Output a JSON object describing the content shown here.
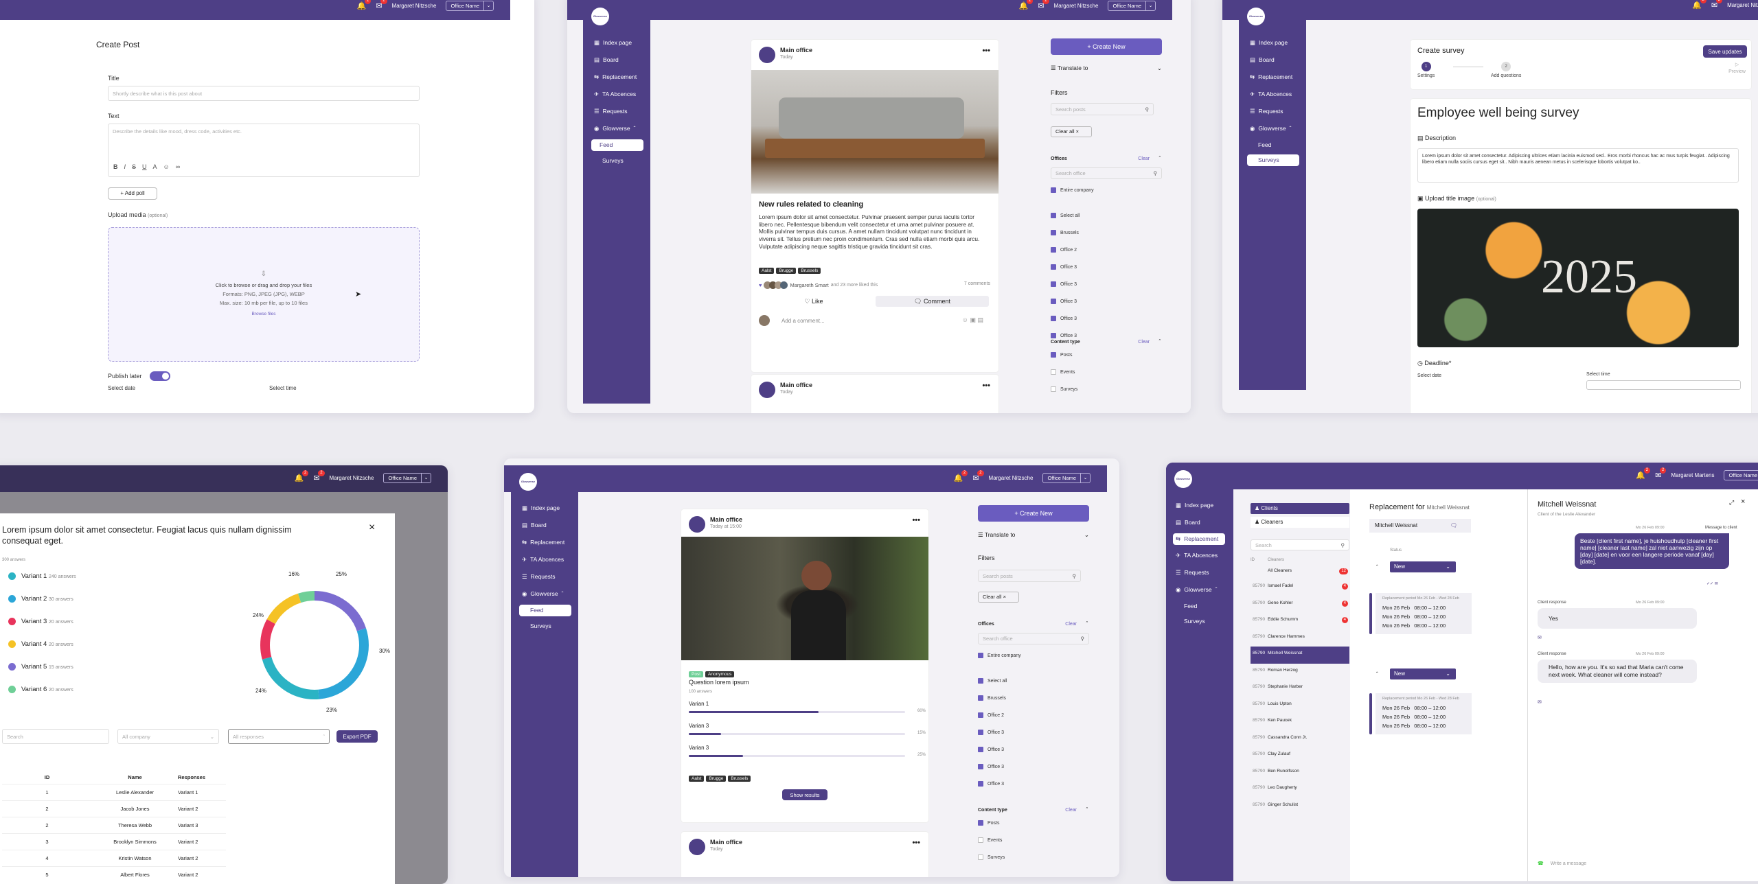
{
  "topbar": {
    "user": "Margaret Nitzsche",
    "office": "Office Name",
    "bell_count": "2",
    "mail_count": "2"
  },
  "topbar_alt": {
    "user": "Margaret Martens"
  },
  "logo_text": "Glowverse",
  "nav": {
    "index": "Index page",
    "board": "Board",
    "replacement": "Replacement",
    "ta": "TA Abcences",
    "requests": "Requests",
    "glowverse": "Glowverse",
    "feed": "Feed",
    "surveys": "Surveys"
  },
  "create_post": {
    "heading": "Create Post",
    "title_label": "Title",
    "title_placeholder": "Shortly describe what is this post about",
    "text_label": "Text",
    "text_placeholder": "Describe the details like mood, dress code, activities etc.",
    "add_poll": "+ Add poll",
    "upload_label": "Upload media",
    "optional": "(optional)",
    "drop_1": "Click to browse or drag and drop your files",
    "drop_2": "Formats: PNG, JPEG (JPG), WEBP",
    "drop_3": "Max. size: 10 mb per file, up to 10 files",
    "browse": "Browse files",
    "publish_later": "Publish later",
    "select_date": "Select date",
    "select_time": "Select time"
  },
  "feed": {
    "office": "Main office",
    "today": "Today",
    "today_time": "Today at 15:00",
    "post_title": "New rules related to cleaning",
    "body": "Lorem ipsum dolor sit amet consectetur. Pulvinar praesent semper purus iaculis tortor libero nec. Pellentesque bibendum velit consectetur et urna amet pulvinar posuere at. Mollis pulvinar tempus duis cursus. A amet nullam tincidunt volutpat nunc tincidunt in viverra sit. Tellus pretium nec proin condimentum. Cras sed nulla etiam morbi quis arcu. Vulputate adipiscing neque sagittis tristique gravida tincidunt sit cras.",
    "tags": [
      "Aalst",
      "Brugge",
      "Brussels"
    ],
    "likes": "Margareth Smart",
    "likes_more": "and 23 more liked this",
    "comments": "7 comments",
    "like": "Like",
    "comment": "Comment",
    "add_comment": "Add a comment...",
    "more": "•••"
  },
  "filters": {
    "create_new": "+ Create New",
    "translate": "Translate to",
    "filters": "Filters",
    "search_posts": "Search posts",
    "clear_all": "Clear all",
    "offices": "Offices",
    "clear": "Clear",
    "search_office": "Search office",
    "entire_company": "Entire company",
    "select_all": "Select all",
    "brussels": "Brussels",
    "office_2": "Office 2",
    "office_3": "Office 3",
    "content_type": "Content type",
    "posts": "Posts",
    "events": "Events",
    "surveys": "Surveys"
  },
  "survey": {
    "heading": "Create survey",
    "save": "Save updates",
    "step1": "Settings",
    "step2": "Add questions",
    "step3": "Preview",
    "title": "Employee well being survey",
    "desc_label": "Description",
    "desc": "Lorem ipsum dolor sit amet consectetur. Adipiscing ultrices etiam lacinia euismod sed.. Eros morbi rhoncus hac ac mus turpis feugiat.. Adipiscing libero etiam nulla sociis cursus eget sit.. Nibh mauris aenean metus in scelerisque lobortis volutpat ko..",
    "upload": "Upload title image",
    "optional": "(optional)",
    "image_text": "2025",
    "deadline": "Deadline*",
    "select_date": "Select date",
    "select_time": "Select time"
  },
  "results": {
    "question": "Lorem ipsum dolor sit amet consectetur. Feugiat lacus quis nullam dignissim consequat eget.",
    "answers": "300 answers",
    "variants": [
      {
        "label": "Variant 1",
        "count": "240 answers",
        "color": "#2bb3c4"
      },
      {
        "label": "Variant 2",
        "count": "30 answers",
        "color": "#2ba6d8"
      },
      {
        "label": "Variant 3",
        "count": "20 answers",
        "color": "#e8345c"
      },
      {
        "label": "Variant 4",
        "count": "20 answers",
        "color": "#f5c225"
      },
      {
        "label": "Variant 5",
        "count": "15 answers",
        "color": "#7b6cd0"
      },
      {
        "label": "Variant 6",
        "count": "20 answers",
        "color": "#6fcf97"
      }
    ],
    "pct": [
      "16%",
      "25%",
      "24%",
      "30%",
      "24%",
      "23%"
    ],
    "search": "Search",
    "company": "All company",
    "responses": "All responses",
    "export": "Export PDF",
    "cols": [
      "ID",
      "Name",
      "Responses"
    ],
    "rows": [
      [
        "1",
        "Leslie Alexander",
        "Variant 1"
      ],
      [
        "2",
        "Jacob Jones",
        "Variant 2"
      ],
      [
        "2",
        "Theresa Webb",
        "Variant 3"
      ],
      [
        "3",
        "Brooklyn Simmons",
        "Variant 2"
      ],
      [
        "4",
        "Kristin Watson",
        "Variant 2"
      ],
      [
        "5",
        "Albert Flores",
        "Variant 2"
      ]
    ]
  },
  "poll_post": {
    "tag1": "Post",
    "tag2": "Anonymous",
    "question": "Question lorem ipsum",
    "answers": "100 answers",
    "options": [
      {
        "label": "Varian 1",
        "pct": "60%",
        "value": 0.6
      },
      {
        "label": "Varian 3",
        "pct": "15%",
        "value": 0.15
      },
      {
        "label": "Varian 3",
        "pct": "25%",
        "value": 0.25
      }
    ],
    "show": "Show results"
  },
  "replacement": {
    "clients": "Clients",
    "cleaners": "Cleaners",
    "search": "Search",
    "id": "ID",
    "cleaners_col": "Cleaners",
    "all": "All Cleaners",
    "all_count": "12",
    "list": [
      [
        "85790",
        "Ismael Fadel",
        "4"
      ],
      [
        "85790",
        "Gene Kohler",
        "4"
      ],
      [
        "85790",
        "Eddie Schumm",
        "4"
      ],
      [
        "85790",
        "Clarence Hammes",
        ""
      ],
      [
        "85790",
        "Mitchell Weissnat",
        ""
      ],
      [
        "85790",
        "Roman Herzog",
        ""
      ],
      [
        "85790",
        "Stephanie Harber",
        ""
      ],
      [
        "85790",
        "Louis Upton",
        ""
      ],
      [
        "85790",
        "Ken Paucek",
        ""
      ],
      [
        "85790",
        "Cassandra Conn Jr.",
        ""
      ],
      [
        "85790",
        "Clay Zulauf",
        ""
      ],
      [
        "85790",
        "Ben Runolfsson",
        ""
      ],
      [
        "85790",
        "Leo Daugherty",
        ""
      ],
      [
        "85790",
        "Ginger Schulist",
        ""
      ]
    ],
    "repl_for": "Replacement for",
    "person": "Mitchell Weissnat",
    "status": "Status",
    "new": "New",
    "period": "Replacement period Mo 26 Feb - Wed 28 Feb",
    "dates": [
      "Mon 26 Feb",
      "08:00 – 12:00"
    ]
  },
  "chat": {
    "name": "Mitchell Weissnat",
    "sub": "Client of the Leslie Alexander",
    "meta": "Mo 26 Feb 09:00",
    "msg_to": "Message to client",
    "msg": "Beste [client first name], je huishoudhulp [cleaner first name] [cleaner last name] zal niet aanwezig zijn op [day] [date] en voor een langere periode vanaf [day] [date].",
    "resp_label": "Client response",
    "resp1": "Yes",
    "resp2": "Hello, how are you. It's so sad that Maria can't come next week. What cleaner will come instead?",
    "write": "Write a message"
  }
}
